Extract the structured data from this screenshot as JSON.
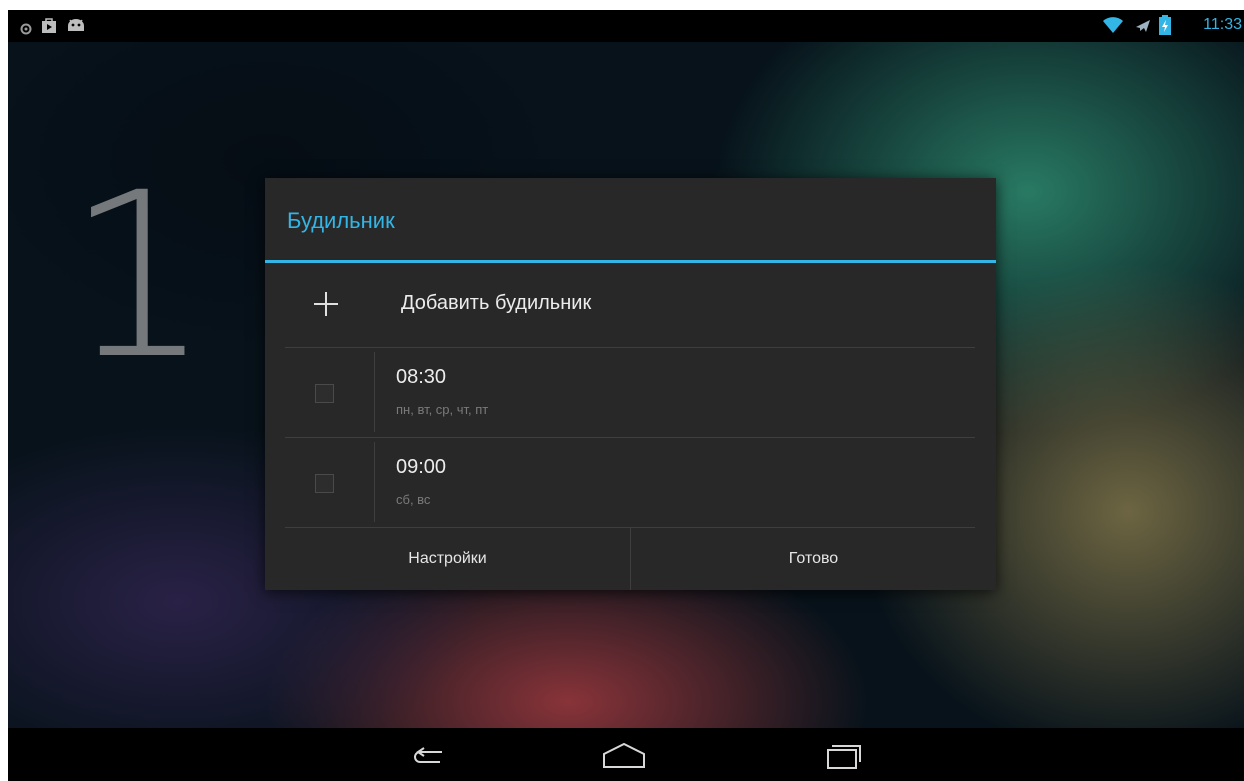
{
  "status_bar": {
    "left_icons": [
      "settings-dot-icon",
      "play-store-icon",
      "android-icon"
    ],
    "right_icons": [
      "wifi-icon",
      "airplane-icon",
      "battery-charging-icon"
    ],
    "time": "11:33"
  },
  "background": {
    "clock_digit": "1"
  },
  "dialog": {
    "title": "Будильник",
    "add_alarm_label": "Добавить будильник",
    "alarms": [
      {
        "time": "08:30",
        "days": "пн, вт, ср, чт, пт",
        "enabled": false
      },
      {
        "time": "09:00",
        "days": "сб, вс",
        "enabled": false
      }
    ],
    "buttons": {
      "settings": "Настройки",
      "done": "Готово"
    }
  },
  "nav_bar": {
    "buttons": [
      "back-icon",
      "home-icon",
      "recents-icon"
    ]
  },
  "colors": {
    "accent": "#33b5e5",
    "dialog_bg": "#282828",
    "divider": "#3e3e3e"
  }
}
